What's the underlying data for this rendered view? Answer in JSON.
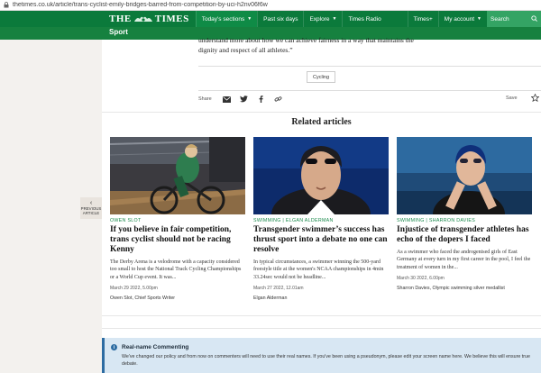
{
  "browser": {
    "url": "thetimes.co.uk/article/trans-cyclist-emily-bridges-barred-from-competition-by-uci-h2nv06f6w"
  },
  "nav": {
    "logo_left": "THE",
    "logo_right": "TIMES",
    "items": [
      {
        "label": "Today's sections",
        "active": true,
        "dropdown": true
      },
      {
        "label": "Past six days",
        "active": false,
        "dropdown": false
      },
      {
        "label": "Explore",
        "active": false,
        "dropdown": true
      },
      {
        "label": "Times Radio",
        "active": false,
        "dropdown": false
      }
    ],
    "right": {
      "times_plus": "Times+",
      "my_account": "My account",
      "search": "Search"
    }
  },
  "section": {
    "title": "Sport"
  },
  "article": {
    "closing_line_1": "understand more about how we can achieve fairness in a way that maintains the",
    "closing_line_2": "dignity and respect of all athletes.”",
    "tag": "Cycling",
    "share_label": "Share",
    "save_label": "Save"
  },
  "related": {
    "title": "Related articles",
    "previous": {
      "line1": "PREVIOUS",
      "line2": "ARTICLE"
    },
    "cards": [
      {
        "kicker": "OWEN SLOT",
        "headline": "If you believe in fair competition, trans cyclist should not be racing Kenny",
        "summary": "The Derby Arena is a velodrome with a capacity considered too small to host the National Track Cycling Championships or a World Cup event. It was...",
        "date": "March 29 2022, 5.00pm",
        "author": "Owen Slot, Chief Sports Writer"
      },
      {
        "kicker": "SWIMMING | ELGAN ALDERMAN",
        "headline": "Transgender swimmer’s success has thrust sport into a debate no one can resolve",
        "summary": "In typical circumstances, a swimmer winning the 500-yard freestyle title at the women's NCAA championships in 4min 33.24sec would not be headline...",
        "date": "March 27 2022, 12.01am",
        "author": "Elgan Alderman"
      },
      {
        "kicker": "SWIMMING | SHARRON DAVIES",
        "headline": "Injustice of transgender athletes has echo of the dopers I faced",
        "summary": "As a swimmer who faced the androgenised girls of East Germany at every turn in my first career in the pool, I feel the treatment of women in the...",
        "date": "March 30 2022, 6.00pm",
        "author": "Sharron Davies, Olympic swimming silver medallist"
      }
    ]
  },
  "notice": {
    "title": "Real-name Commenting",
    "text": "We've changed our policy and from now on commenters will need to use their real names. If you've been using a pseudonym, please edit your screen name here. We believe this will ensure true debate."
  },
  "colors": {
    "brand_green": "#0b7a3b",
    "section_green": "#16813f",
    "kicker_green": "#1a8a4c",
    "notice_bg": "#d8e7f3",
    "notice_accent": "#2d6ca2"
  }
}
